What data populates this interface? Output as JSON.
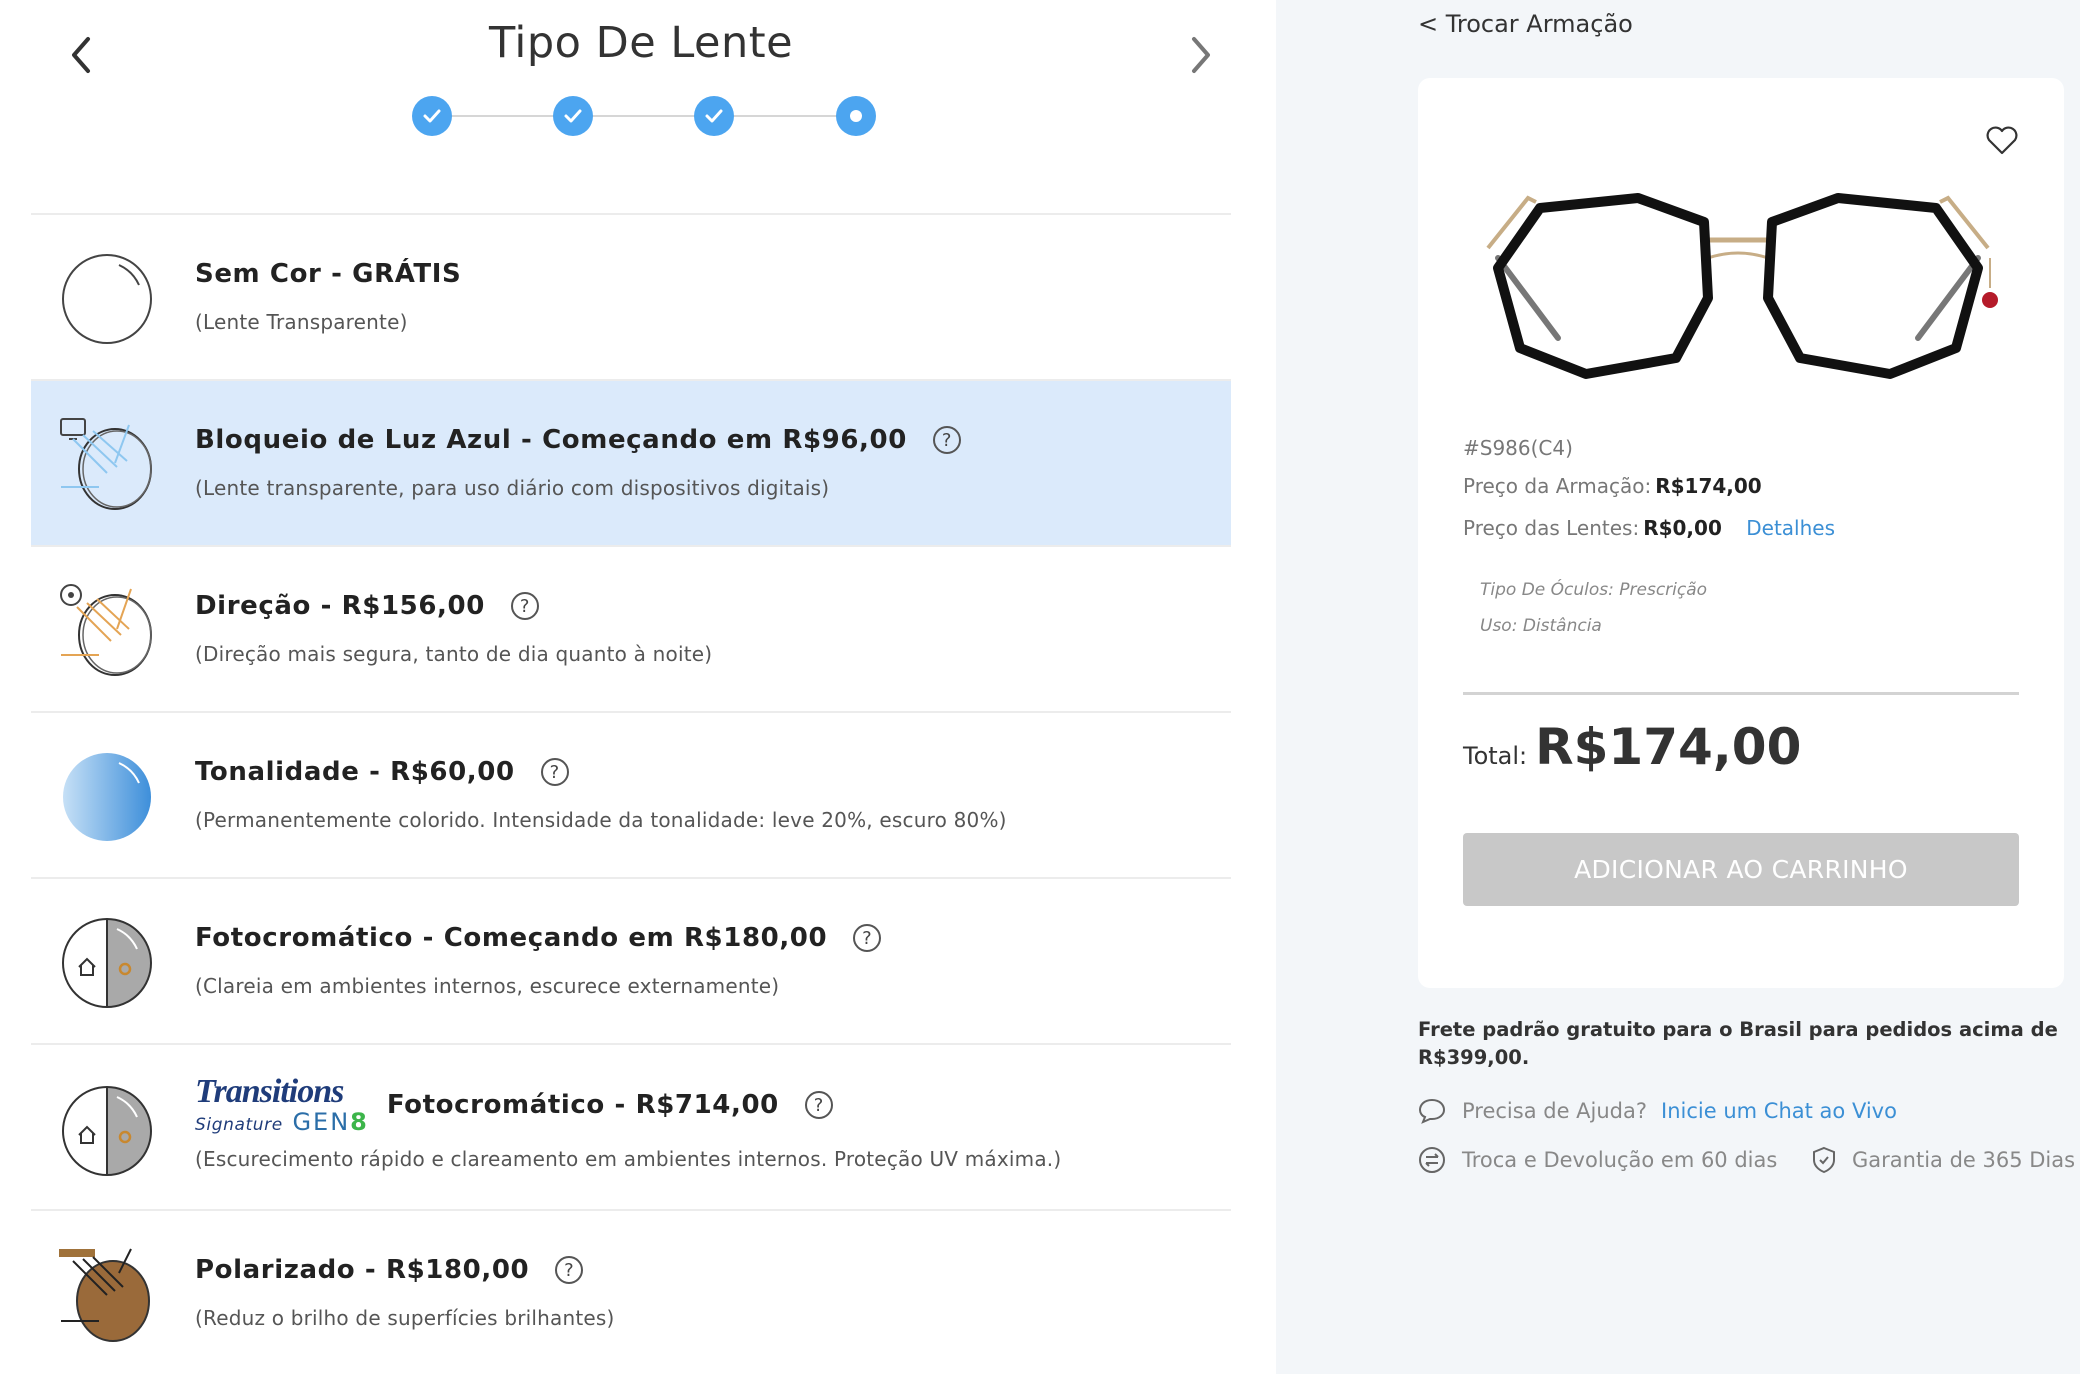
{
  "header": {
    "title": "Tipo De Lente",
    "steps_total": 4,
    "steps_completed": 3
  },
  "options": [
    {
      "title": "Sem Cor - GRÁTIS",
      "desc": "(Lente Transparente)",
      "icon": "clear-lens-icon"
    },
    {
      "title": "Bloqueio de Luz Azul - Começando em R$96,00",
      "desc": "(Lente transparente, para uso diário com dispositivos digitais)",
      "icon": "blue-light-lens-icon"
    },
    {
      "title": "Direção - R$156,00",
      "desc": "(Direção mais segura, tanto de dia quanto à noite)",
      "icon": "driving-lens-icon"
    },
    {
      "title": "Tonalidade - R$60,00",
      "desc": "(Permanentemente colorido. Intensidade da tonalidade: leve 20%, escuro 80%)",
      "icon": "tinted-lens-icon"
    },
    {
      "title": "Fotocromático - Começando em R$180,00",
      "desc": "(Clareia em ambientes internos, escurece externamente)",
      "icon": "photochromic-lens-icon"
    },
    {
      "title": "Fotocromático - R$714,00",
      "desc": "(Escurecimento rápido e clareamento em ambientes internos. Proteção UV máxima.)",
      "icon": "transitions-lens-icon",
      "brand": {
        "line1": "Transitions",
        "line2": "Signature",
        "line3": "GEN",
        "line3_accent": "8"
      }
    },
    {
      "title": "Polarizado - R$180,00",
      "desc": "(Reduz o brilho de superfícies brilhantes)",
      "icon": "polarized-lens-icon"
    }
  ],
  "selected_option_index": 1,
  "help_glyph": "?",
  "sidebar": {
    "back_link": "< Trocar Armação",
    "sku": "#S986(C4)",
    "frame_price_label": "Preço da Armação:",
    "frame_price_value": "R$174,00",
    "lens_price_label": "Preço das Lentes:",
    "lens_price_value": "R$0,00",
    "details_link": "Detalhes",
    "glasses_type": "Tipo De Óculos: Prescrição",
    "use": "Uso: Distância",
    "total_label": "Total:",
    "total_value": "R$174,00",
    "add_to_cart": "ADICIONAR AO CARRINHO",
    "shipping": "Frete padrão gratuito para o Brasil para pedidos acima de R$399,00.",
    "help_text": "Precisa de Ajuda?",
    "chat_link": "Inicie um Chat ao Vivo",
    "returns": "Troca e Devolução em 60 dias",
    "warranty": "Garantia de 365 Dias"
  },
  "colors": {
    "accent": "#4ca5f0",
    "selected_bg": "#dbeafb",
    "link": "#3b8fd5",
    "disabled_button": "#c8c8c8",
    "right_panel_bg": "#f3f6f9"
  }
}
